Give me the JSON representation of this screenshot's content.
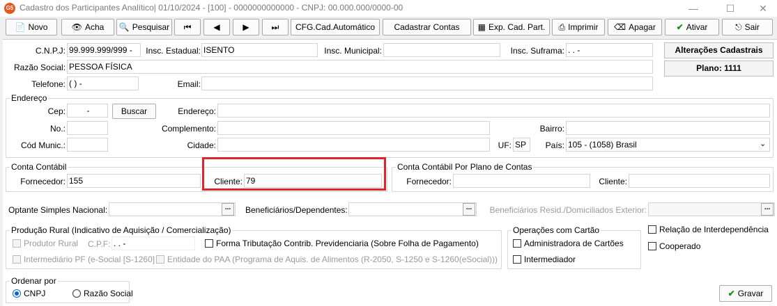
{
  "window": {
    "title": "Cadastro dos Participantes Analítico| 01/10/2024 - [100] - 0000000000000 - CNPJ: 00.000.000/0000-00",
    "app_badge": "G5"
  },
  "toolbar": {
    "novo": "Novo",
    "acha": "Acha",
    "pesquisar": "Pesquisar",
    "cfg": "CFG.Cad.Automático",
    "cadastrar_contas": "Cadastrar Contas",
    "exp": "Exp. Cad. Part.",
    "imprimir": "Imprimir",
    "apagar": "Apagar",
    "ativar": "Ativar",
    "sair": "Sair"
  },
  "main": {
    "cnpj_label": "C.N.P.J:",
    "cnpj_value": "99.999.999/999 -",
    "ie_label": "Insc. Estadual:",
    "ie_value": "ISENTO",
    "im_label": "Insc. Municipal:",
    "im_value": "",
    "suframa_label": "Insc. Suframa:",
    "suframa_value": ".   .   -",
    "razao_label": "Razão Social:",
    "razao_value": "PESSOA FÍSICA",
    "telefone_label": "Telefone:",
    "telefone_value": "(  )    -",
    "email_label": "Email:",
    "email_value": "",
    "alteracoes_btn": "Alterações Cadastrais",
    "plano_btn": "Plano: 1111"
  },
  "endereco": {
    "legend": "Endereço",
    "cep_label": "Cep:",
    "cep_value": "-",
    "buscar": "Buscar",
    "endereco_label": "Endereço:",
    "no_label": "No.:",
    "complemento_label": "Complemento:",
    "bairro_label": "Bairro:",
    "cod_label": "Cód Munic.:",
    "cidade_label": "Cidade:",
    "uf_label": "UF:",
    "uf_value": "SP",
    "pais_label": "País:",
    "pais_value": "105 - (1058) Brasil"
  },
  "conta": {
    "legend": "Conta Contábil",
    "fornecedor_label": "Fornecedor:",
    "fornecedor_value": "155",
    "cliente_label": "Cliente:",
    "cliente_value": "79"
  },
  "conta_plano": {
    "legend": "Conta Contábil Por Plano de Contas",
    "fornecedor_label": "Fornecedor:",
    "cliente_label": "Cliente:"
  },
  "optante": {
    "label": "Optante Simples Nacional:",
    "benef_label": "Beneficiários/Dependentes:",
    "benef_ext_label": "Beneficiários Resid./Domiciliados Exterior:",
    "dots": "..."
  },
  "producao": {
    "legend": "Produção Rural (Indicativo de Aquisição / Comercialização)",
    "produtor": "Produtor Rural",
    "cpf_label": "C.P.F:",
    "cpf_value": ".   .   -",
    "forma": "Forma Tributação Contrib. Previdenciaria (Sobre Folha de Pagamento)",
    "intermediario": "Intermediário PF (e-Social [S-1260]",
    "entidade": "Entidade do PAA (Programa de Aquis. de Alimentos (R-2050, S-1250 e S-1260(eSocial)))"
  },
  "cartao": {
    "legend": "Operações com Cartão",
    "administradora": "Administradora de Cartões",
    "intermediador": "Intermediador"
  },
  "relacao": "Relação de Interdependência",
  "cooperado": "Cooperado",
  "ordenar": {
    "legend": "Ordenar por",
    "cnpj": "CNPJ",
    "razao": "Razão Social"
  },
  "gravar": "Gravar"
}
